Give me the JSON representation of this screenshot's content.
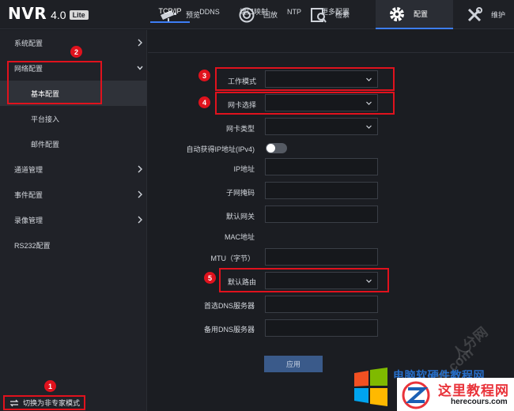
{
  "app": {
    "logo": "NVR",
    "version": "4.0",
    "edition": "Lite"
  },
  "nav": [
    {
      "label": "预览",
      "icon": "camera-icon",
      "active": false
    },
    {
      "label": "回放",
      "icon": "playback-icon",
      "active": false
    },
    {
      "label": "检索",
      "icon": "search-icon",
      "active": false
    },
    {
      "label": "配置",
      "icon": "gear-icon",
      "active": true
    },
    {
      "label": "维护",
      "icon": "tools-icon",
      "active": false
    }
  ],
  "sidebar": {
    "items": [
      {
        "label": "系统配置",
        "expandable": true
      },
      {
        "label": "网络配置",
        "expanded": true
      },
      {
        "label": "基本配置",
        "selected": true
      },
      {
        "label": "平台接入"
      },
      {
        "label": "邮件配置"
      },
      {
        "label": "通道管理",
        "expandable": true
      },
      {
        "label": "事件配置",
        "expandable": true
      },
      {
        "label": "录像管理",
        "expandable": true
      },
      {
        "label": "RS232配置"
      }
    ],
    "mode_button": "切换为非专家模式"
  },
  "tabs": [
    "TCP/IP",
    "DDNS",
    "端口映射",
    "NTP",
    "更多配置"
  ],
  "form": {
    "work_mode": {
      "label": "工作模式",
      "value": ""
    },
    "nic_select": {
      "label": "网卡选择",
      "value": ""
    },
    "nic_type": {
      "label": "网卡类型",
      "value": ""
    },
    "dhcp": {
      "label": "自动获得IP地址(IPv4)",
      "enabled": false
    },
    "ip_address": {
      "label": "IP地址",
      "value": ""
    },
    "subnet_mask": {
      "label": "子网掩码",
      "value": ""
    },
    "gateway": {
      "label": "默认网关",
      "value": ""
    },
    "mac": {
      "label": "MAC地址",
      "value": ""
    },
    "mtu": {
      "label": "MTU（字节）",
      "value": ""
    },
    "default_route": {
      "label": "默认路由",
      "value": ""
    },
    "dns1": {
      "label": "首选DNS服务器",
      "value": ""
    },
    "dns2": {
      "label": "备用DNS服务器",
      "value": ""
    },
    "apply_label": "应用"
  },
  "annotations": [
    "1",
    "2",
    "3",
    "4",
    "5"
  ],
  "watermark": {
    "diagonal": "人分网",
    "diagonal2": "fe.com",
    "blue_text": "电脑软硬件教程网",
    "site_name": "这里教程网",
    "site_url": "herecours.com"
  },
  "colors": {
    "accent": "#3d7ef5",
    "annotation": "#e0121d",
    "apply_button": "#3a5a8a"
  }
}
